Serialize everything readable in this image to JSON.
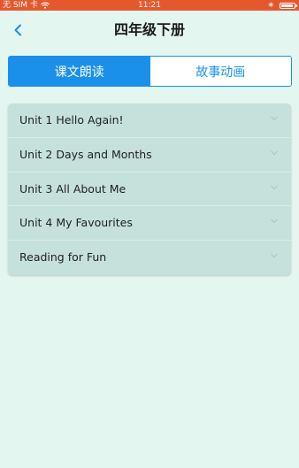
{
  "status_bar": {
    "carrier": "无 SIM 卡",
    "time": "11:21",
    "bluetooth_symbol": "∗",
    "icons": [
      "wifi-icon",
      "bluetooth-icon",
      "battery-icon"
    ],
    "background_color": "#e5582d"
  },
  "nav": {
    "title": "四年级下册",
    "back_icon": "chevron-left-icon"
  },
  "tabs": [
    {
      "label": "课文朗读",
      "active": true
    },
    {
      "label": "故事动画",
      "active": false
    }
  ],
  "units": [
    {
      "label": "Unit 1 Hello Again!"
    },
    {
      "label": "Unit 2 Days and Months"
    },
    {
      "label": "Unit 3 All About Me"
    },
    {
      "label": "Unit 4 My Favourites"
    },
    {
      "label": "Reading for Fun"
    }
  ],
  "colors": {
    "accent": "#1a90ea",
    "page_background": "#e3f6f0",
    "list_background": "#c6e1dc"
  }
}
